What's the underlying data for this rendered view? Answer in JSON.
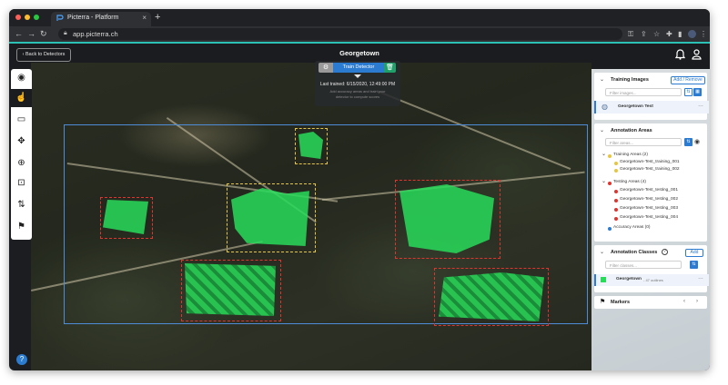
{
  "browser": {
    "tab_title": "Picterra - Platform",
    "tab_close": "×",
    "new_tab": "+",
    "url": "app.picterra.ch"
  },
  "header": {
    "back_label": "‹ Back to Detectors",
    "title": "Georgetown"
  },
  "train_panel": {
    "train_label": "Train Detector",
    "last_trained": "Last trained: 6/15/2020, 12:49:00 PM",
    "hint_line1": "Add accuracy areas and train your",
    "hint_line2": "detector to compute scores"
  },
  "training_images": {
    "title": "Training Images",
    "add_remove": "Add / Remove",
    "filter_placeholder": "Filter images...",
    "items": [
      {
        "label": "Georgetown Test"
      }
    ]
  },
  "annotation_areas": {
    "title": "Annotation Areas",
    "filter_placeholder": "Filter areas...",
    "training_group": "Training Areas (2)",
    "training_items": [
      "Georgetown-Test_training_001",
      "Georgetown-Test_training_002"
    ],
    "testing_group": "Testing Areas (4)",
    "testing_items": [
      "Georgetown-Test_testing_001",
      "Georgetown-Test_testing_002",
      "Georgetown-Test_testing_003",
      "Georgetown-Test_testing_004"
    ],
    "accuracy_group": "Accuracy Areas (0)"
  },
  "annotation_classes": {
    "title": "Annotation Classes",
    "add": "Add",
    "filter_placeholder": "Filter classes...",
    "class_name": "Georgetown",
    "class_count": "- 47 outlines"
  },
  "markers": {
    "title": "Markers"
  },
  "colors": {
    "accent": "#2b7bd1",
    "teal": "#2bc1b5",
    "training": "#e6c640",
    "testing": "#e0352e",
    "annotation": "#28dc5a"
  }
}
